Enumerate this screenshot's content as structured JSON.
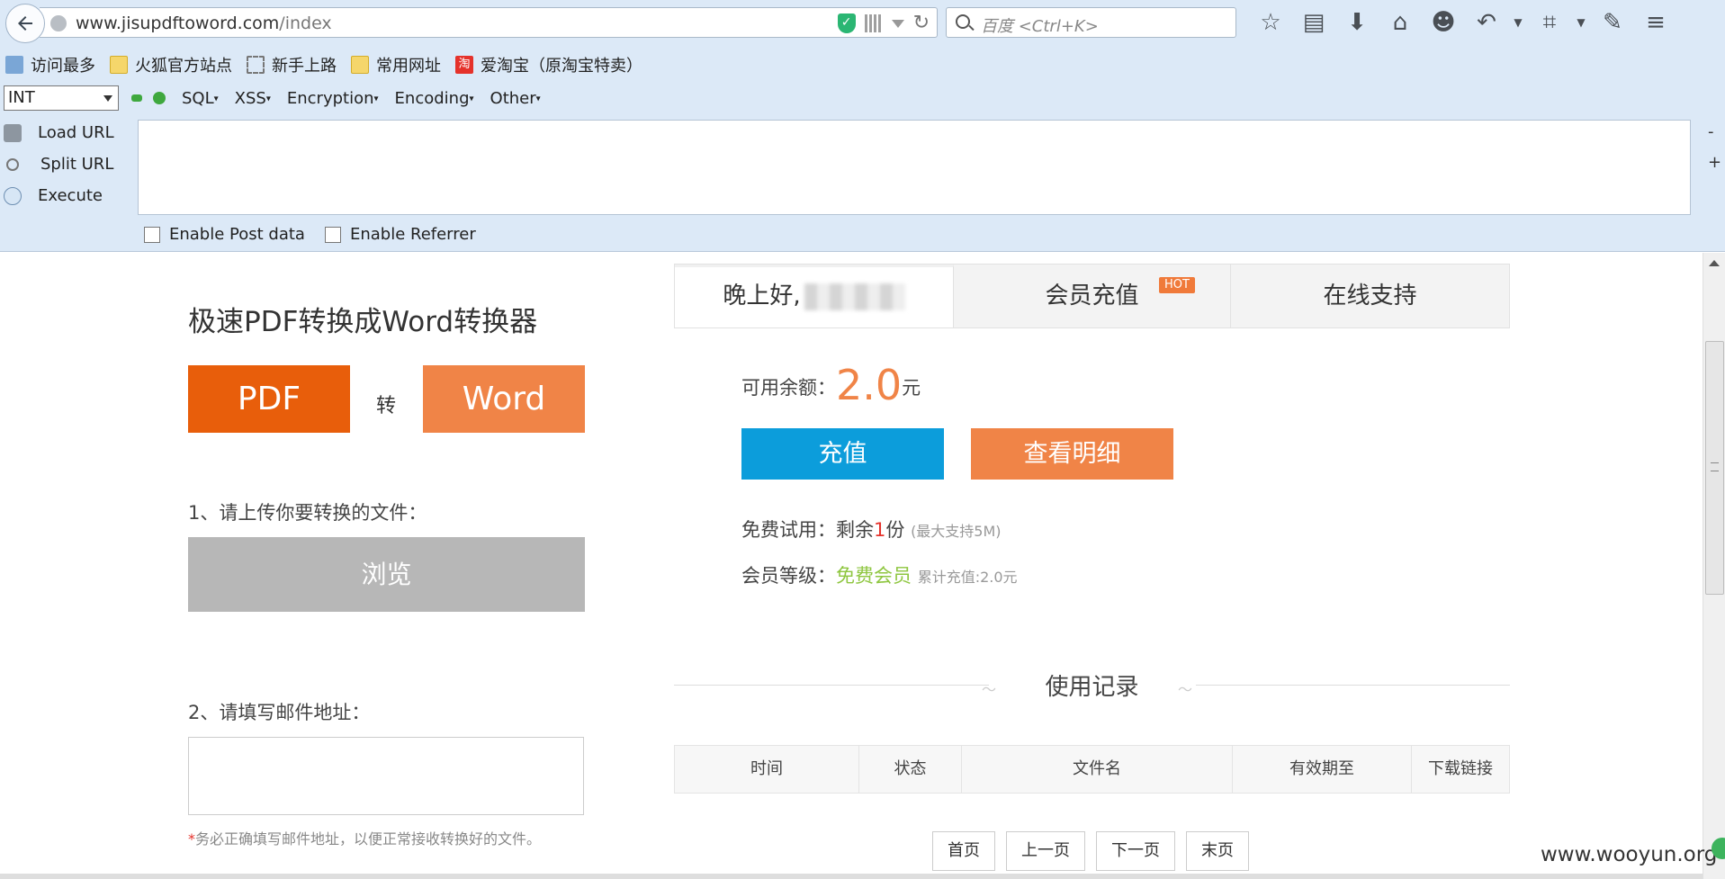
{
  "browser": {
    "url_domain": "www.jisupdftoword.com",
    "url_path": "/index",
    "search_placeholder": "百度 <Ctrl+K>",
    "toolbar_icons": [
      "star-icon",
      "reading-list-icon",
      "download-icon",
      "home-icon",
      "chat-bubble-icon",
      "undo-icon",
      "crop-icon",
      "comment-icon",
      "menu-icon"
    ]
  },
  "bookmarks": [
    {
      "label": "访问最多",
      "icon": "search"
    },
    {
      "label": "火狐官方站点",
      "icon": "folder"
    },
    {
      "label": "新手上路",
      "icon": "dashed"
    },
    {
      "label": "常用网址",
      "icon": "folder"
    },
    {
      "label": "爱淘宝（原淘宝特卖）",
      "icon": "taobao"
    }
  ],
  "hackbar": {
    "select_value": "INT",
    "menus": [
      "SQL",
      "XSS",
      "Encryption",
      "Encoding",
      "Other"
    ],
    "actions": [
      "Load URL",
      "Split URL",
      "Execute"
    ],
    "side_minus": "-",
    "side_plus": "+",
    "checkboxes": [
      "Enable Post data",
      "Enable Referrer"
    ]
  },
  "converter": {
    "title": "极速PDF转换成Word转换器",
    "pdf_label": "PDF",
    "to_label": "转",
    "word_label": "Word",
    "step1": "1、请上传你要转换的文件：",
    "browse_label": "浏览",
    "step2": "2、请填写邮件地址：",
    "email_note_star": "*",
    "email_note": "务必正确填写邮件地址，以便正常接收转换好的文件。"
  },
  "account": {
    "tabs": [
      "晚上好,",
      "会员充值",
      "在线支持"
    ],
    "hot_badge": "HOT",
    "balance_label": "可用余额：",
    "balance_amount": "2.0",
    "balance_unit": "元",
    "recharge_label": "充值",
    "details_label": "查看明细",
    "trial_label": "免费试用：剩余",
    "trial_count": "1",
    "trial_unit": "份",
    "trial_note": "(最大支持5M)",
    "level_label": "会员等级：",
    "level_value": "免费会员",
    "level_note": "累计充值:2.0元"
  },
  "records": {
    "title": "使用记录",
    "columns": [
      "时间",
      "状态",
      "文件名",
      "有效期至",
      "下载链接"
    ],
    "pager": [
      "首页",
      "上一页",
      "下一页",
      "末页"
    ]
  },
  "watermark": "www.wooyun.org",
  "colors": {
    "pdf": "#e85e0b",
    "word": "#f08447",
    "recharge": "#0c9ddb",
    "green_level": "#8ec63f",
    "chrome_bg": "#dce9f7"
  }
}
